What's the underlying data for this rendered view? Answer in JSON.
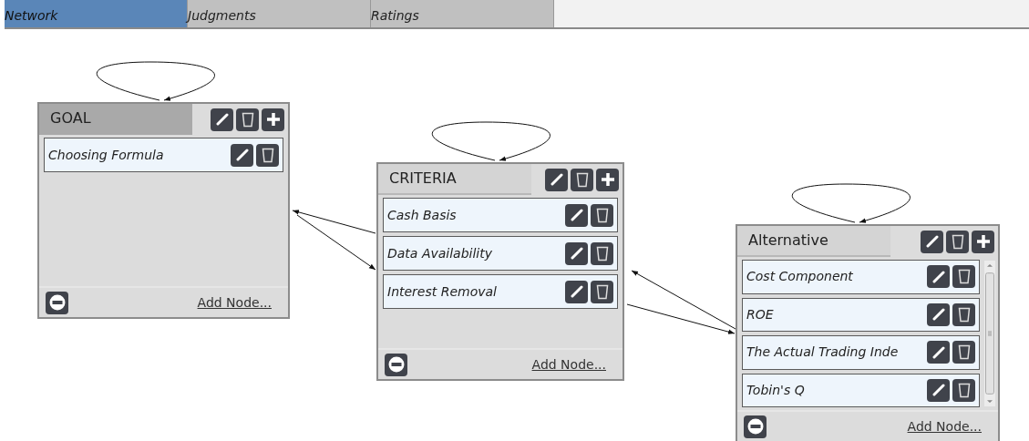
{
  "tabs": [
    {
      "label": "Network",
      "selected": true
    },
    {
      "label": "Judgments",
      "selected": false
    },
    {
      "label": "Ratings",
      "selected": false
    }
  ],
  "clusters": [
    {
      "title": "GOAL",
      "selected": true,
      "items": [
        {
          "label": "Choosing Formula"
        }
      ],
      "add_label": "Add Node..."
    },
    {
      "title": "CRITERIA",
      "selected": false,
      "items": [
        {
          "label": "Cash Basis"
        },
        {
          "label": "Data Availability"
        },
        {
          "label": "Interest Removal"
        }
      ],
      "add_label": "Add Node..."
    },
    {
      "title": "Alternative",
      "selected": false,
      "items": [
        {
          "label": "Cost Component"
        },
        {
          "label": "ROE"
        },
        {
          "label": "The Actual Trading Inde"
        },
        {
          "label": "Tobin's Q"
        }
      ],
      "add_label": "Add Node..."
    }
  ]
}
